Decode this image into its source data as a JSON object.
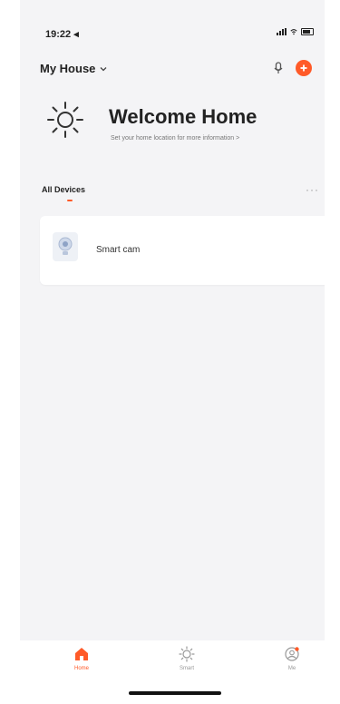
{
  "status_bar": {
    "time": "19:22 ◂"
  },
  "header": {
    "house_name": "My House",
    "icons": [
      "mic-icon",
      "add-icon"
    ],
    "accent": "#ff5a28"
  },
  "welcome": {
    "title": "Welcome Home",
    "subtitle": "Set your home location for more information >",
    "icon": "sun-icon"
  },
  "devices_section": {
    "label": "All Devices",
    "more": "···"
  },
  "devices": [
    {
      "name": "Smart cam",
      "icon": "camera-icon"
    }
  ],
  "tabbar": {
    "tabs": [
      {
        "label": "Home",
        "icon": "home-icon",
        "active": true
      },
      {
        "label": "Smart",
        "icon": "smart-icon",
        "active": false
      },
      {
        "label": "Me",
        "icon": "me-icon",
        "active": false
      }
    ]
  }
}
